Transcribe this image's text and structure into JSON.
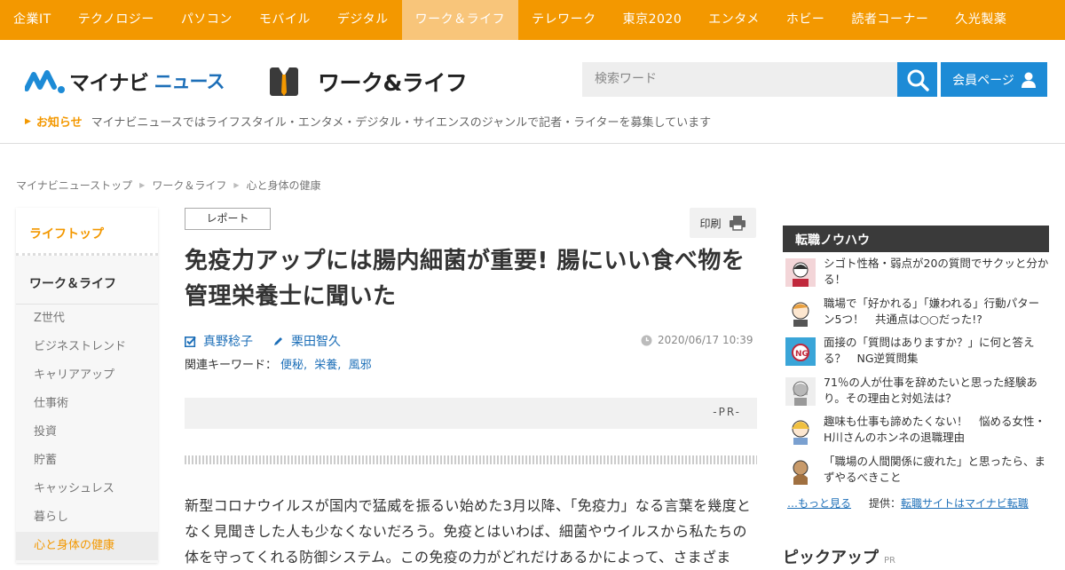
{
  "topnav": [
    "企業IT",
    "テクノロジー",
    "パソコン",
    "モバイル",
    "デジタル",
    "ワーク＆ライフ",
    "テレワーク",
    "東京2020",
    "エンタメ",
    "ホビー",
    "読者コーナー",
    "久光製薬"
  ],
  "header": {
    "brand": "マイナビ",
    "brand_suffix": "ニュース",
    "section_title": "ワーク&ライフ",
    "search_placeholder": "検索ワード",
    "member_label": "会員ページ"
  },
  "notice": {
    "label": "お知らせ",
    "text": "マイナビニュースではライフスタイル・エンタメ・デジタル・サイエンスのジャンルで記者・ライターを募集しています"
  },
  "breadcrumb": [
    "マイナビニューストップ",
    "ワーク＆ライフ",
    "心と身体の健康"
  ],
  "sidebar": {
    "top": "ライフトップ",
    "section": "ワーク＆ライフ",
    "items": [
      "Z世代",
      "ビジネストレンド",
      "キャリアアップ",
      "仕事術",
      "投資",
      "貯蓄",
      "キャッシュレス",
      "暮らし",
      "心と身体の健康"
    ]
  },
  "article": {
    "tag": "レポート",
    "print_label": "印刷",
    "title": "免疫力アップには腸内細菌が重要! 腸にいい食べ物を管理栄養士に聞いた",
    "author1": "真野稔子",
    "author2": "栗田智久",
    "date": "2020/06/17 10:39",
    "keywords_label": "関連キーワード：",
    "keywords": [
      "便秘,",
      "栄養,",
      "風邪"
    ],
    "pr": "-PR-",
    "body": "新型コロナウイルスが国内で猛威を振るい始めた3月以降、「免疫力」なる言葉を幾度となく見聞きした人も少なくないだろう。免疫とはいわば、細菌やウイルスから私たちの体を守ってくれる防御システム。この免疫の力がどれだけあるかによって、さまざま"
  },
  "right": {
    "heading": "転職ノウハウ",
    "items": [
      "シゴト性格・弱点が20の質問でサクッと分かる！",
      "職場で「好かれる」「嫌われる」行動パターン5つ！　共通点は○○だった!?",
      "面接の「質問はありますか？」に何と答える？　NG逆質問集",
      "71％の人が仕事を辞めたいと思った経験あり。その理由と対処法は？",
      "趣味も仕事も諦めたくない！　悩める女性・H川さんのホンネの退職理由",
      "「職場の人間関係に疲れた」と思ったら、まずやるべきこと"
    ],
    "more": "…もっと見る",
    "provider_label": "提供：",
    "provider": "転職サイトはマイナビ転職",
    "pickup": "ピックアップ",
    "pickup_small": "PR"
  },
  "colors": {
    "accent": "#f39800",
    "link": "#1d6fb8",
    "button": "#1d8bd6"
  }
}
